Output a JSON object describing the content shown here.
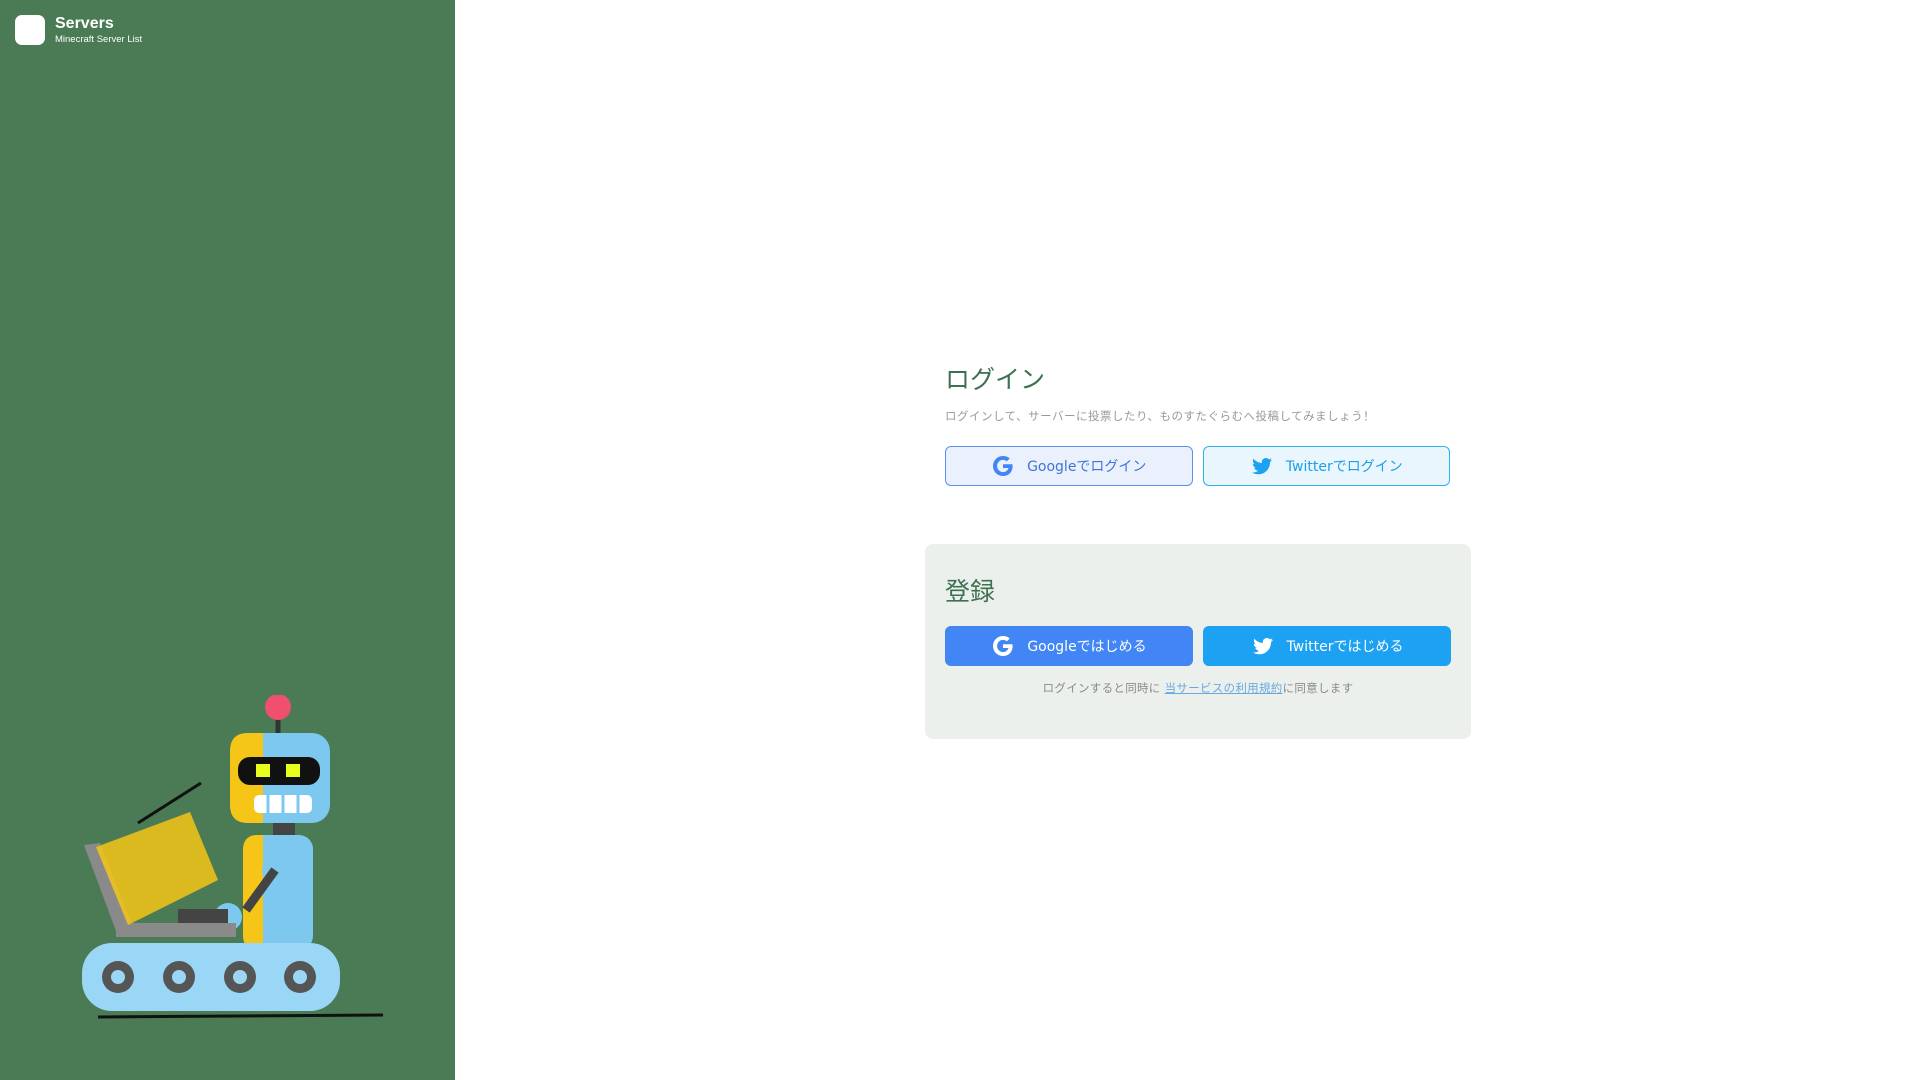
{
  "brand": {
    "title": "Servers",
    "subtitle": "Minecraft Server List",
    "sidebar_color": "#4a7b55"
  },
  "login": {
    "title": "ログイン",
    "description": "ログインして、サーバーに投票したり、ものすたぐらむへ投稿してみましょう！",
    "google_button": "Googleでログイン",
    "twitter_button": "Twitterでログイン"
  },
  "register": {
    "title": "登録",
    "google_button": "Googleではじめる",
    "twitter_button": "Twitterではじめる",
    "terms_prefix": "ログインすると同時に",
    "terms_link": "当サービスの利用規約",
    "terms_suffix": "に同意します"
  },
  "icons": {
    "google": "google-g-icon",
    "twitter": "twitter-bird-icon"
  },
  "colors": {
    "accent_green": "#3e7150",
    "google_blue": "#4285f4",
    "twitter_blue": "#1da1f2"
  }
}
